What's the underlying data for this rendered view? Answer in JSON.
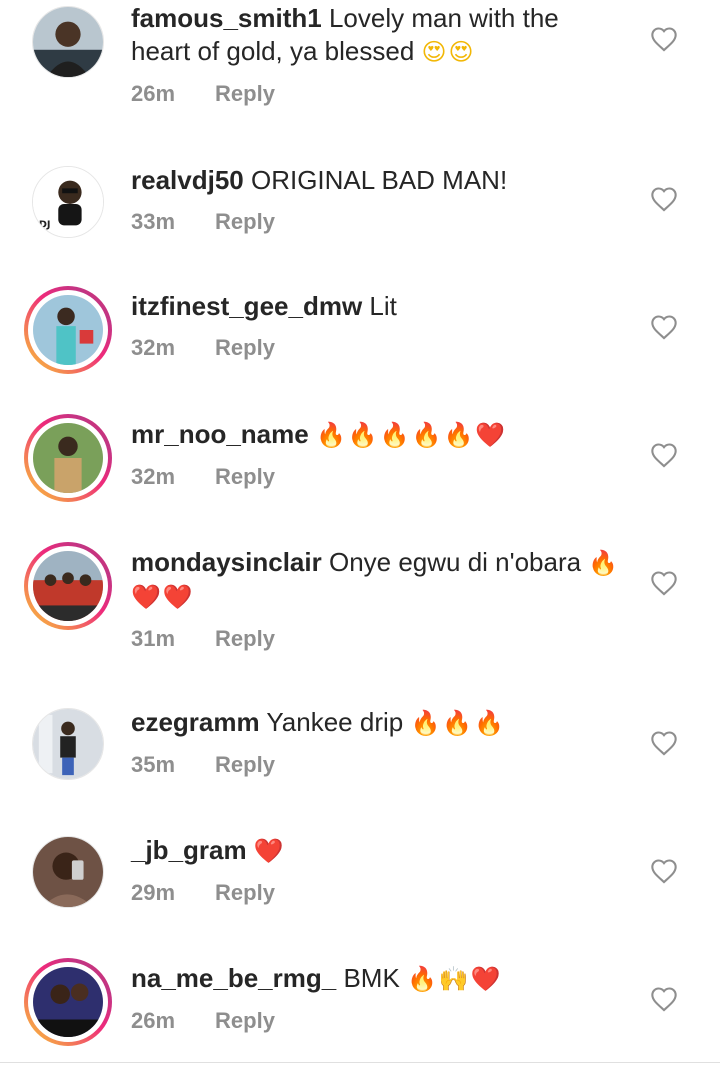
{
  "comments": [
    {
      "username": "famous_smith1",
      "text": "Lovely man with the heart of gold, ya blessed",
      "emoji": "😍😍",
      "time": "26m",
      "reply": "Reply",
      "avatar": "plain",
      "avatar_color": "#5a6b7a"
    },
    {
      "username": "realvdj50",
      "text": "ORIGINAL BAD MAN!",
      "emoji": "",
      "time": "33m",
      "reply": "Reply",
      "avatar": "plain",
      "avatar_color": "#ffffff"
    },
    {
      "username": "itzfinest_gee_dmw",
      "text": "Lit",
      "emoji": "",
      "time": "32m",
      "reply": "Reply",
      "avatar": "story",
      "avatar_color": "#6aa7c9"
    },
    {
      "username": "mr_noo_name",
      "text": "",
      "emoji": "🔥🔥🔥🔥🔥❤️",
      "time": "32m",
      "reply": "Reply",
      "avatar": "story",
      "avatar_color": "#6b8f4e"
    },
    {
      "username": "mondaysinclair",
      "text": "Onye egwu di n'obara",
      "emoji": "🔥❤️❤️",
      "time": "31m",
      "reply": "Reply",
      "avatar": "story",
      "avatar_color": "#c0392b"
    },
    {
      "username": "ezegramm",
      "text": "Yankee drip",
      "emoji": "🔥🔥🔥",
      "time": "35m",
      "reply": "Reply",
      "avatar": "plain",
      "avatar_color": "#c9cdd4"
    },
    {
      "username": "_jb_gram",
      "text": "",
      "emoji": "❤️",
      "time": "29m",
      "reply": "Reply",
      "avatar": "plain",
      "avatar_color": "#7b5a4a"
    },
    {
      "username": "na_me_be_rmg_",
      "text": "BMK",
      "emoji": "🔥🙌❤️",
      "time": "26m",
      "reply": "Reply",
      "avatar": "story",
      "avatar_color": "#3b3f8f"
    }
  ],
  "colors": {
    "text": "#262626",
    "meta": "#8e8e8e",
    "heart_outline": "#8e8e8e"
  },
  "icons": {
    "like": "heart-outline-icon"
  }
}
